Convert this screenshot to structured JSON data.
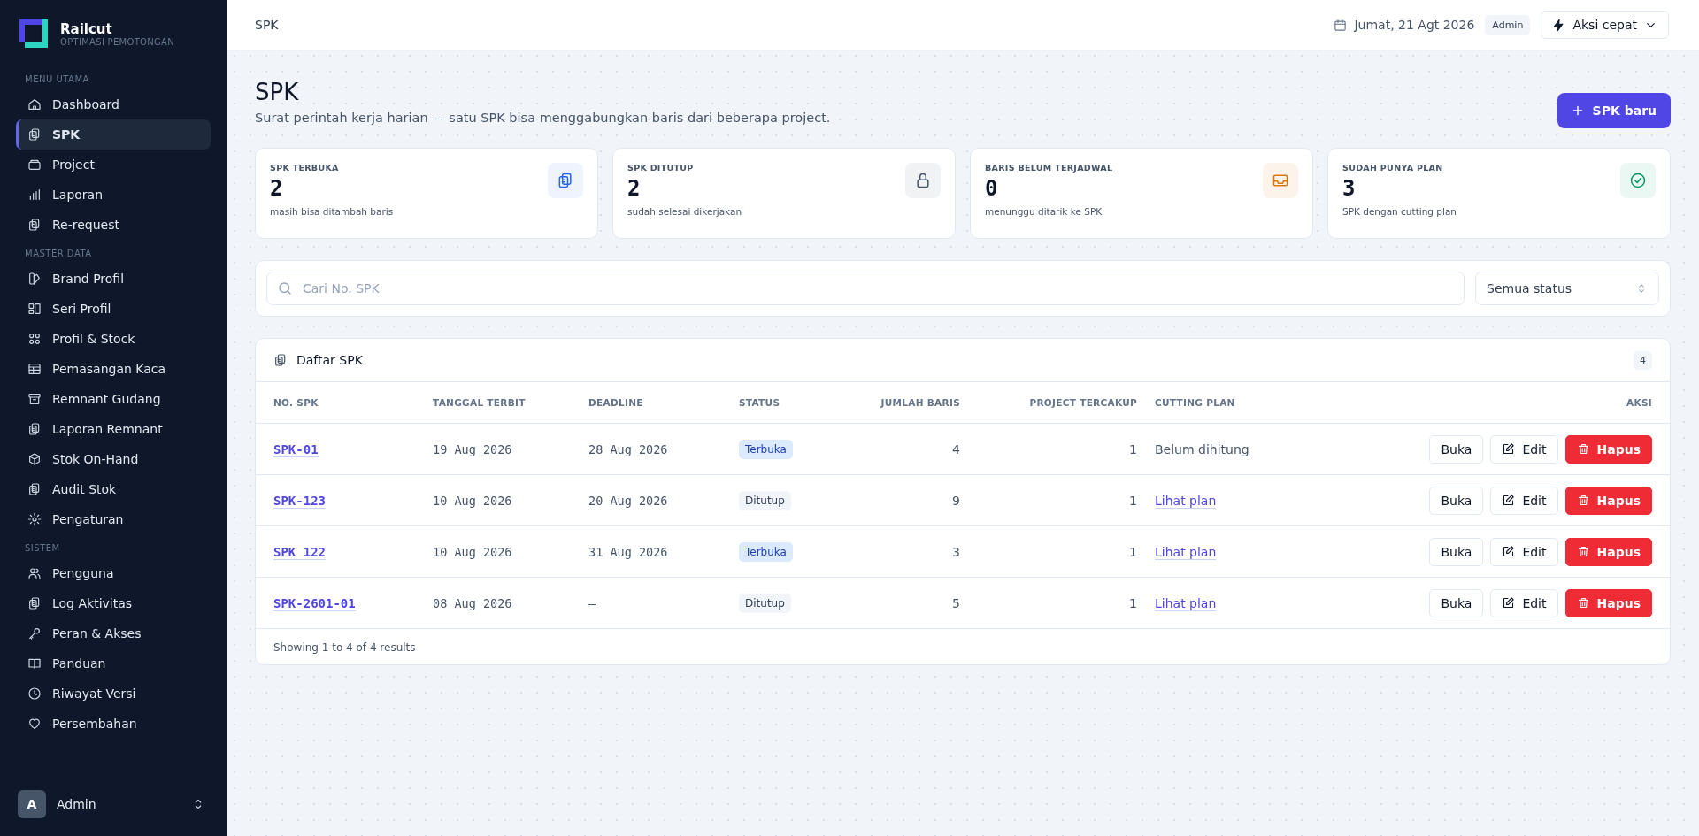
{
  "brand": {
    "name": "Railcut",
    "tagline": "OPTIMASI PEMOTONGAN"
  },
  "sidebar": {
    "sections": [
      {
        "title": "MENU UTAMA",
        "items": [
          {
            "label": "Dashboard",
            "selected": false
          },
          {
            "label": "SPK",
            "selected": true
          },
          {
            "label": "Project",
            "selected": false
          },
          {
            "label": "Laporan",
            "selected": false
          },
          {
            "label": "Re-request",
            "selected": false
          }
        ]
      },
      {
        "title": "MASTER DATA",
        "items": [
          {
            "label": "Brand Profil",
            "selected": false
          },
          {
            "label": "Seri Profil",
            "selected": false
          },
          {
            "label": "Profil & Stock",
            "selected": false
          },
          {
            "label": "Pemasangan Kaca",
            "selected": false
          },
          {
            "label": "Remnant Gudang",
            "selected": false
          },
          {
            "label": "Laporan Remnant",
            "selected": false
          },
          {
            "label": "Stok On-Hand",
            "selected": false
          },
          {
            "label": "Audit Stok",
            "selected": false
          },
          {
            "label": "Pengaturan",
            "selected": false
          }
        ]
      },
      {
        "title": "SISTEM",
        "items": [
          {
            "label": "Pengguna",
            "selected": false
          },
          {
            "label": "Log Aktivitas",
            "selected": false
          },
          {
            "label": "Peran & Akses",
            "selected": false
          },
          {
            "label": "Panduan",
            "selected": false
          },
          {
            "label": "Riwayat Versi",
            "selected": false
          },
          {
            "label": "Persembahan",
            "selected": false
          }
        ]
      }
    ],
    "user": {
      "initial": "A",
      "name": "Admin"
    }
  },
  "topbar": {
    "breadcrumb": "SPK",
    "date": "Jumat, 21 Agt 2026",
    "role": "Admin",
    "quick_action": "Aksi cepat"
  },
  "page": {
    "title": "SPK",
    "subtitle": "Surat perintah kerja harian — satu SPK bisa menggabungkan baris dari beberapa project.",
    "new_button": "SPK baru"
  },
  "stats": [
    {
      "label": "SPK TERBUKA",
      "value": "2",
      "note": "masih bisa ditambah baris",
      "color": "#2563eb"
    },
    {
      "label": "SPK DITUTUP",
      "value": "2",
      "note": "sudah selesai dikerjakan",
      "color": "#475569"
    },
    {
      "label": "BARIS BELUM TERJADWAL",
      "value": "0",
      "note": "menunggu ditarik ke SPK",
      "color": "#d97706"
    },
    {
      "label": "SUDAH PUNYA PLAN",
      "value": "3",
      "note": "SPK dengan cutting plan",
      "color": "#059669"
    }
  ],
  "filters": {
    "search_placeholder": "Cari No. SPK",
    "status_select": "Semua status"
  },
  "table": {
    "title": "Daftar SPK",
    "count": "4",
    "columns": [
      "NO. SPK",
      "TANGGAL TERBIT",
      "DEADLINE",
      "STATUS",
      "JUMLAH BARIS",
      "PROJECT TERCAKUP",
      "CUTTING PLAN",
      "AKSI"
    ],
    "rows": [
      {
        "no": "SPK-01",
        "issued": "19 Aug 2026",
        "deadline": "28 Aug 2026",
        "status": {
          "label": "Terbuka",
          "kind": "open"
        },
        "rows": "4",
        "projects": "1",
        "plan": {
          "text": "Belum dihitung",
          "kind": "text"
        },
        "actions": [
          "Buka",
          "Edit",
          "Hapus"
        ]
      },
      {
        "no": "SPK-123",
        "issued": "10 Aug 2026",
        "deadline": "20 Aug 2026",
        "status": {
          "label": "Ditutup",
          "kind": "closed"
        },
        "rows": "9",
        "projects": "1",
        "plan": {
          "text": "Lihat plan",
          "kind": "link"
        },
        "actions": [
          "Buka",
          "Edit",
          "Hapus"
        ]
      },
      {
        "no": "SPK 122",
        "issued": "10 Aug 2026",
        "deadline": "31 Aug 2026",
        "status": {
          "label": "Terbuka",
          "kind": "open"
        },
        "rows": "3",
        "projects": "1",
        "plan": {
          "text": "Lihat plan",
          "kind": "link"
        },
        "actions": [
          "Buka",
          "Edit",
          "Hapus"
        ]
      },
      {
        "no": "SPK-2601-01",
        "issued": "08 Aug 2026",
        "deadline": "—",
        "status": {
          "label": "Ditutup",
          "kind": "closed"
        },
        "rows": "5",
        "projects": "1",
        "plan": {
          "text": "Lihat plan",
          "kind": "link"
        },
        "actions": [
          "Buka",
          "Edit",
          "Hapus"
        ]
      }
    ],
    "footer": "Showing 1 to 4 of 4 results"
  }
}
